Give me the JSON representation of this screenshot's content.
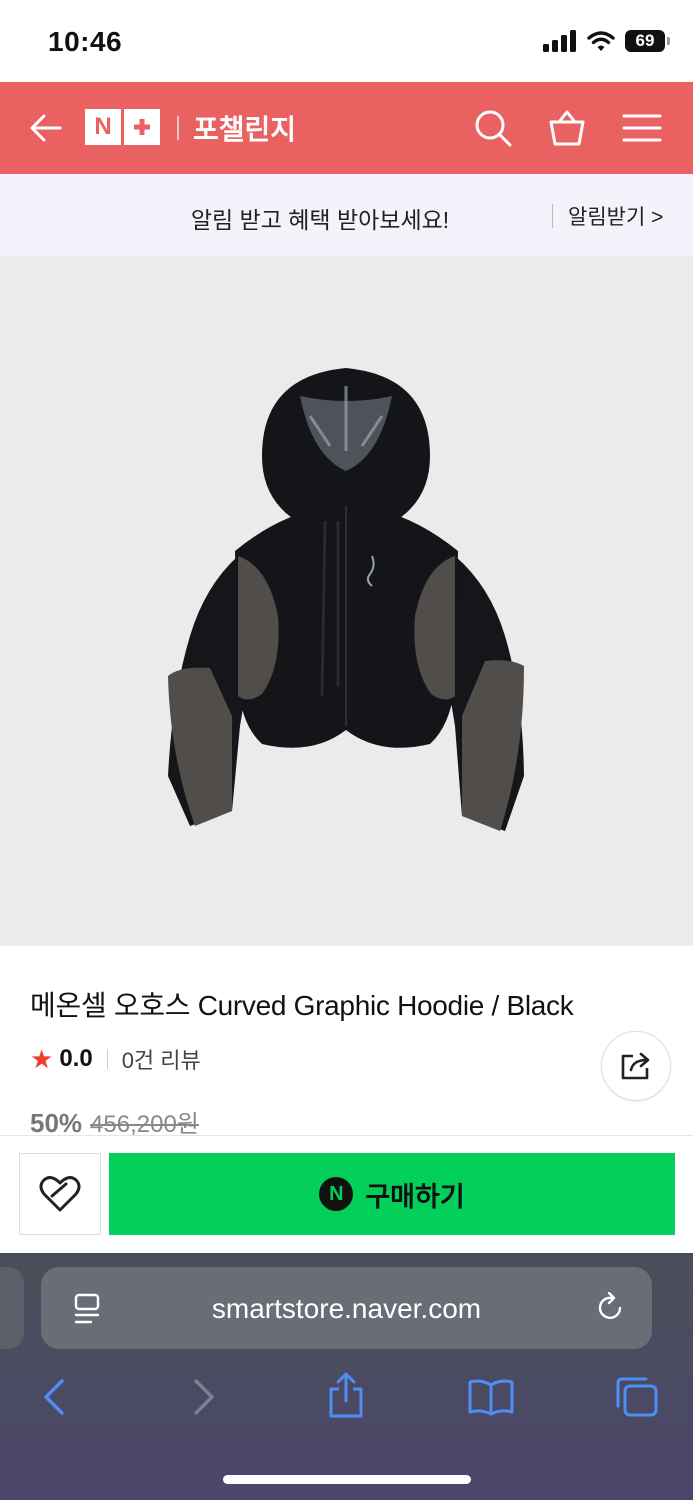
{
  "status_bar": {
    "time": "10:46",
    "battery": "69"
  },
  "header": {
    "store_name": "포챌린지",
    "logo": "N+"
  },
  "notice": {
    "message": "알림 받고 혜택 받아보세요!",
    "action": "알림받기 >"
  },
  "product": {
    "title": "메온셀 오호스 Curved Graphic Hoodie / Black",
    "rating": "0.0",
    "review_count": "0건 리뷰",
    "discount": "50%",
    "original_price": "456,200원"
  },
  "buy_bar": {
    "buy_label": "구매하기",
    "naver_logo": "N"
  },
  "browser": {
    "url": "smartstore.naver.com"
  },
  "colors": {
    "brand": "#E96161",
    "buy": "#03D05A",
    "star": "#F03E2F"
  }
}
